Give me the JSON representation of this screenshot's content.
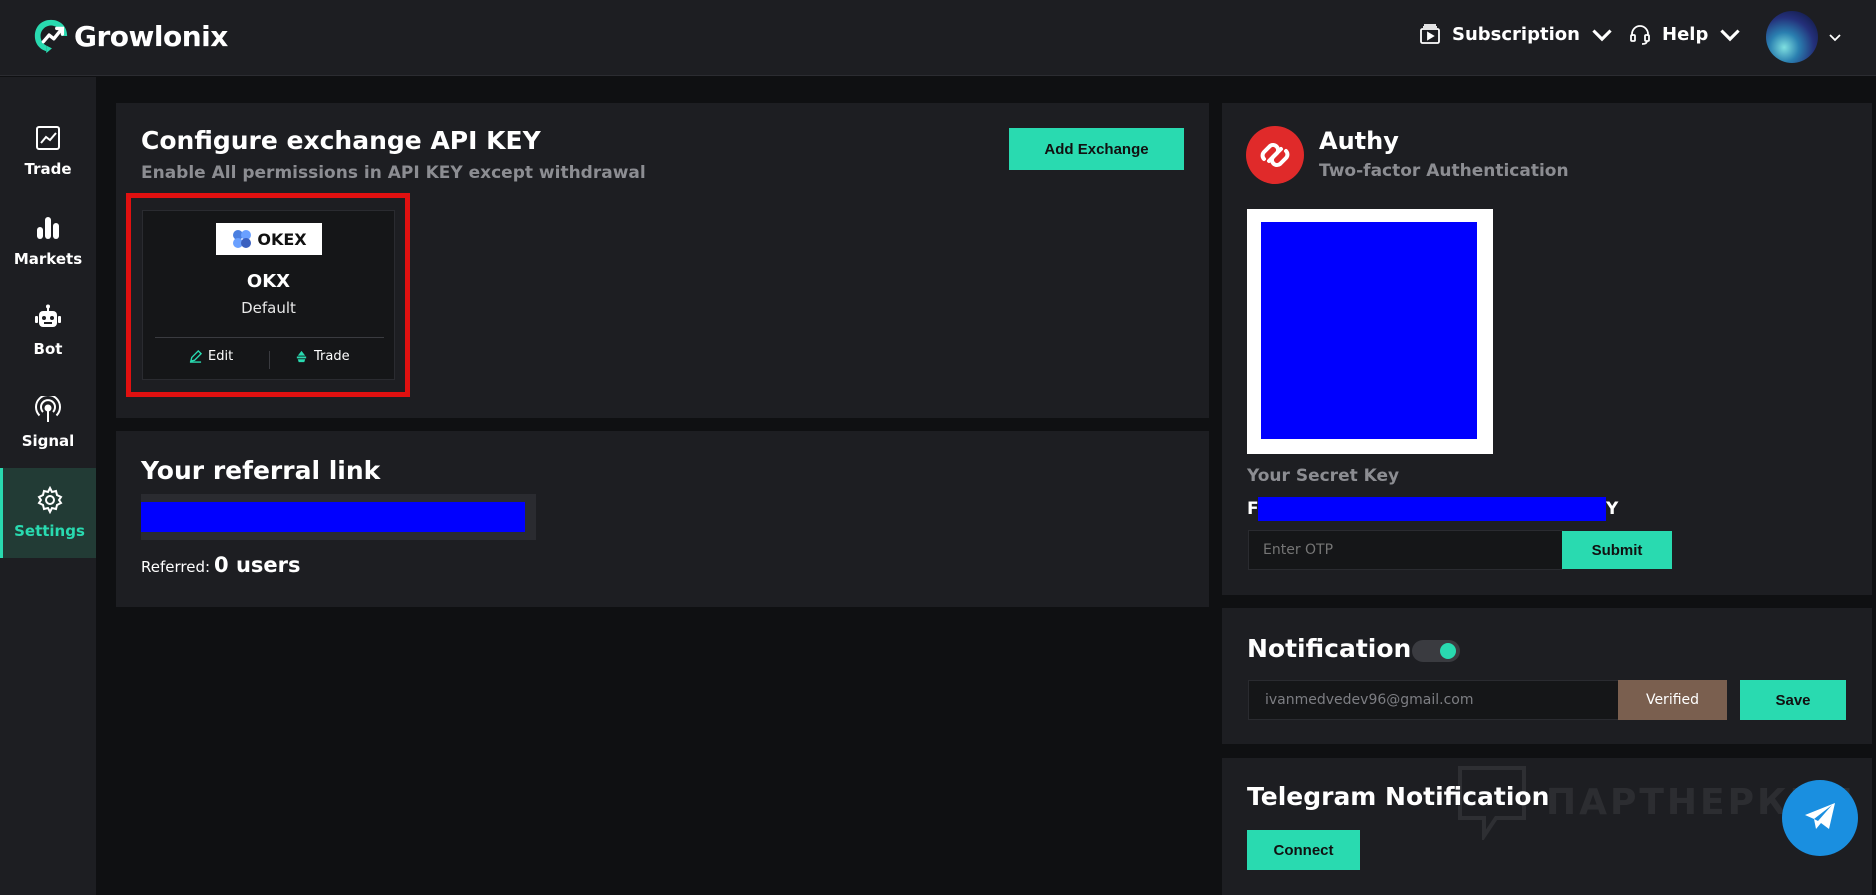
{
  "brand": {
    "name": "Growlonix",
    "accent": "#29dab0"
  },
  "header": {
    "subscription_label": "Subscription",
    "help_label": "Help"
  },
  "sidebar": {
    "items": [
      {
        "label": "Trade",
        "icon": "chart-line-icon"
      },
      {
        "label": "Markets",
        "icon": "bar-chart-icon"
      },
      {
        "label": "Bot",
        "icon": "robot-icon"
      },
      {
        "label": "Signal",
        "icon": "broadcast-icon"
      },
      {
        "label": "Settings",
        "icon": "gear-icon",
        "active": true
      }
    ]
  },
  "exchange": {
    "title": "Configure exchange API KEY",
    "subtitle": "Enable All permissions in API KEY except withdrawal",
    "add_button": "Add Exchange",
    "card": {
      "logo_text": "OKEX",
      "name": "OKX",
      "status": "Default",
      "edit_label": "Edit",
      "trade_label": "Trade"
    }
  },
  "referral": {
    "title": "Your referral link",
    "referred_label": "Referred:",
    "referred_count": "0 users"
  },
  "authy": {
    "title": "Authy",
    "subtitle": "Two-factor Authentication",
    "secret_label": "Your Secret Key",
    "secret_start": "F",
    "secret_end": "Y",
    "otp_placeholder": "Enter OTP",
    "submit_label": "Submit"
  },
  "notification": {
    "title": "Notification",
    "enabled": true,
    "email": "ivanmedvedev96@gmail.com",
    "verified_label": "Verified",
    "save_label": "Save"
  },
  "telegram": {
    "title": "Telegram Notification",
    "connect_label": "Connect"
  },
  "watermark": {
    "text": "ПАРТНЕРКИН"
  }
}
